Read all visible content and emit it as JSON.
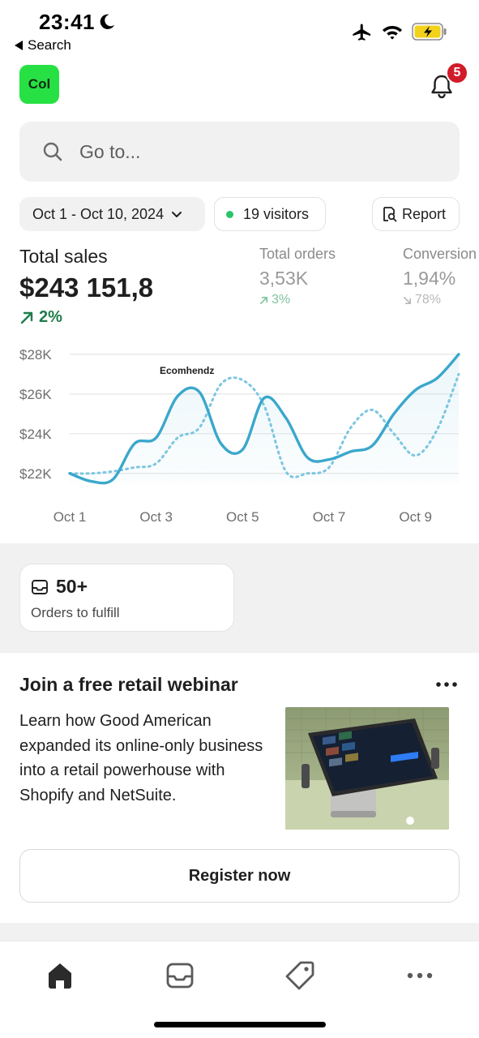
{
  "status_bar": {
    "time": "23:41",
    "back_label": "Search"
  },
  "header": {
    "store_initials": "Col",
    "notification_count": "5"
  },
  "search": {
    "placeholder": "Go to..."
  },
  "filters": {
    "date_range": "Oct 1 - Oct 10, 2024",
    "visitors": "19 visitors",
    "report_label": "Report"
  },
  "metrics": {
    "total_sales": {
      "label": "Total sales",
      "value": "$243 151,8",
      "change": "2%"
    },
    "total_orders": {
      "label": "Total orders",
      "value": "3,53K",
      "change": "3%"
    },
    "conversion": {
      "label": "Conversion",
      "value": "1,94%",
      "change": "78%"
    }
  },
  "chart_watermark": "Ecomhendz",
  "chart_data": {
    "type": "line",
    "x": [
      "Oct 1",
      "Oct 1.5",
      "Oct 2",
      "Oct 2.5",
      "Oct 3",
      "Oct 3.5",
      "Oct 4",
      "Oct 4.5",
      "Oct 5",
      "Oct 5.5",
      "Oct 6",
      "Oct 6.5",
      "Oct 7",
      "Oct 7.5",
      "Oct 8",
      "Oct 8.5",
      "Oct 9",
      "Oct 9.5",
      "Oct 10"
    ],
    "x_ticks": [
      "Oct 1",
      "Oct 3",
      "Oct 5",
      "Oct 7",
      "Oct 9"
    ],
    "y_ticks": [
      "$22K",
      "$26K",
      "$24K",
      "$28K"
    ],
    "y_tick_values": [
      22000,
      26000,
      24000,
      28000
    ],
    "ylim": [
      21500,
      28200
    ],
    "series": [
      {
        "values": [
          22000,
          21600,
          21700,
          23500,
          23800,
          25900,
          26100,
          23500,
          23200,
          25800,
          24800,
          22800,
          22700,
          23100,
          23400,
          25000,
          26200,
          26800,
          28000
        ]
      },
      {
        "values": [
          22000,
          22000,
          22100,
          22300,
          22500,
          23800,
          24300,
          26500,
          26700,
          25400,
          22100,
          22000,
          22300,
          24300,
          25200,
          24000,
          22900,
          24200,
          27000
        ]
      }
    ],
    "colors": {
      "current": "#3aa7cc",
      "previous": "#7cc6e0",
      "grid": "#e6e6e6"
    }
  },
  "fulfill": {
    "count": "50+",
    "caption": "Orders to fulfill"
  },
  "webinar": {
    "title": "Join a free retail webinar",
    "body": "Learn how Good American expanded its online-only business into a retail powerhouse with Shopify and NetSuite.",
    "button_label": "Register now"
  },
  "colors": {
    "accent_green": "#27e044",
    "badge_red": "#d21b2a",
    "positive": "#1f7d4c"
  }
}
